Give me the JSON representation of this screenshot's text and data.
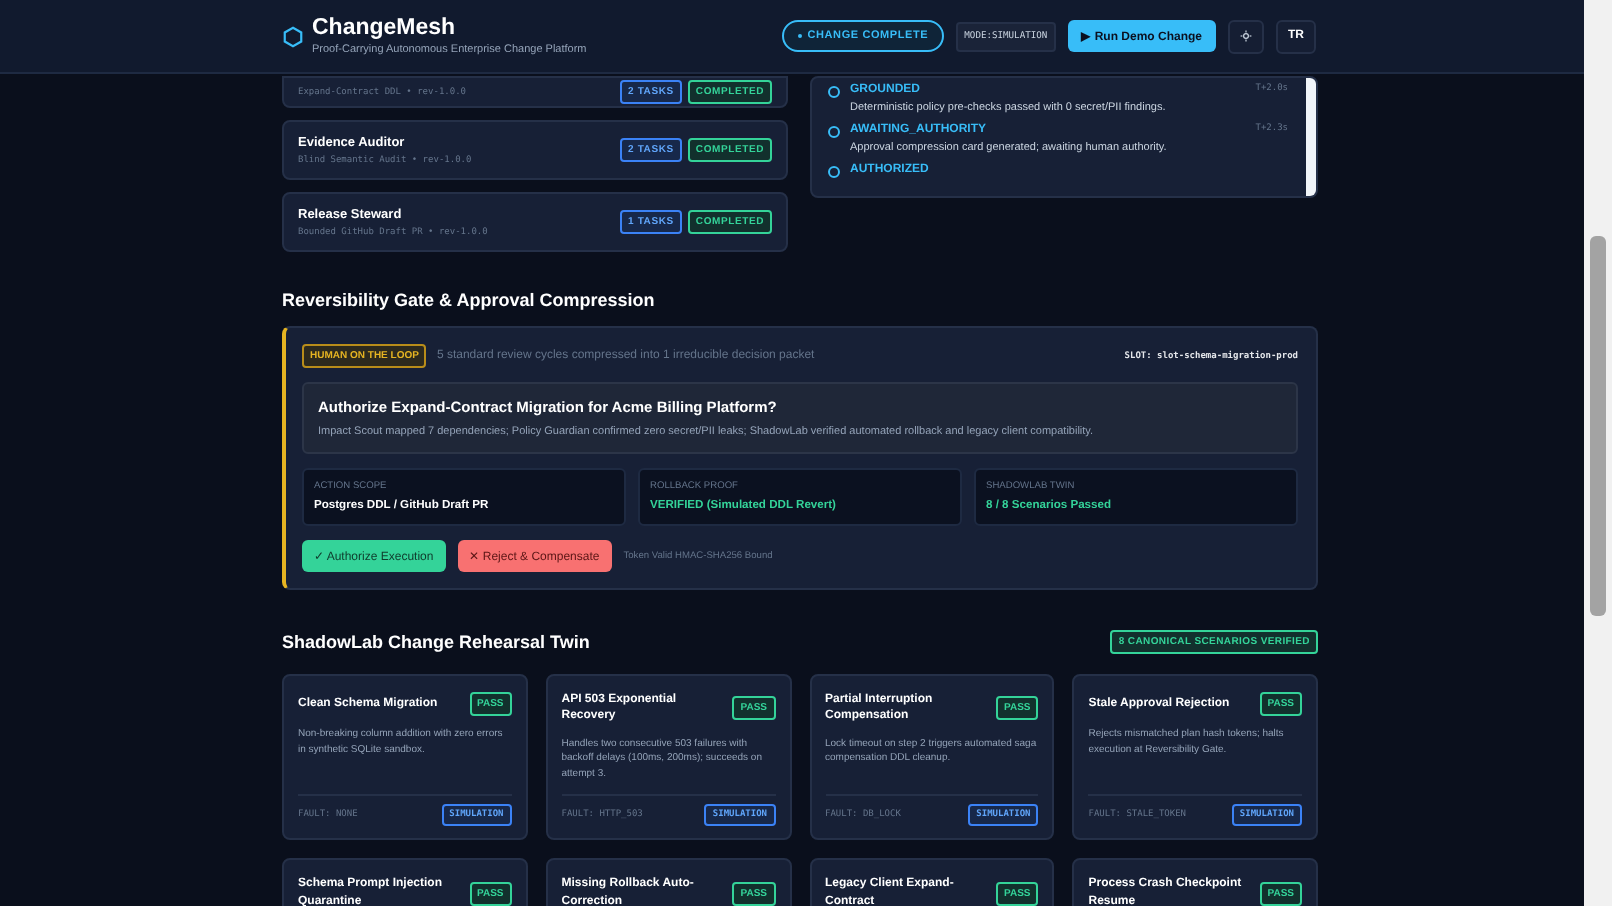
{
  "header": {
    "title": "ChangeMesh",
    "subtitle": "Proof-Carrying Autonomous Enterprise Change Platform",
    "status": "CHANGE COMPLETE",
    "mode": "MODE:SIMULATION",
    "run_button": "▶ Run Demo Change",
    "user": "TR"
  },
  "agents": [
    {
      "subtitle": "Expand-Contract DDL • rev-1.0.0",
      "tasks": "2 TASKS",
      "status": "COMPLETED",
      "kind": "done"
    },
    {
      "name": "Evidence Auditor",
      "subtitle": "Blind Semantic Audit • rev-1.0.0",
      "tasks": "2 TASKS",
      "status": "COMPLETED",
      "kind": "done"
    },
    {
      "name": "Release Steward",
      "subtitle": "Bounded GitHub Draft PR • rev-1.0.0",
      "tasks": "1 TASKS",
      "status": "COMPLETED",
      "kind": "done"
    }
  ],
  "timeline": [
    {
      "state": "GROUNDED",
      "time": "T+2.0s",
      "description": "Deterministic policy pre-checks passed with 0 secret/PII findings."
    },
    {
      "state": "AWAITING_AUTHORITY",
      "time": "T+2.3s",
      "description": "Approval compression card generated; awaiting human authority."
    },
    {
      "state": "AUTHORIZED"
    }
  ],
  "gate": {
    "title": "Reversibility Gate & Approval Compression",
    "badge": "HUMAN ON THE LOOP",
    "summary": "5 standard review cycles compressed into 1 irreducible decision packet",
    "slot": "SLOT: slot-schema-migration-prod",
    "question": "Authorize Expand-Contract Migration for Acme Billing Platform?",
    "question_detail": "Impact Scout mapped 7 dependencies; Policy Guardian confirmed zero secret/PII leaks; ShadowLab verified automated rollback and legacy client compatibility.",
    "facts": [
      {
        "label": "ACTION SCOPE",
        "value": "Postgres DDL / GitHub Draft PR",
        "kind": "plain"
      },
      {
        "label": "ROLLBACK PROOF",
        "value": "VERIFIED (Simulated DDL Revert)",
        "kind": "verified"
      },
      {
        "label": "SHADOWLAB TWIN",
        "value": "8 / 8 Scenarios Passed",
        "kind": "verified"
      }
    ],
    "approve_button": "✓ Authorize Execution",
    "reject_button": "✕ Reject & Compensate",
    "token_note": "Token Valid HMAC-SHA256 Bound"
  },
  "shadowlab": {
    "title": "ShadowLab Change Rehearsal Twin",
    "badge": "8 CANONICAL SCENARIOS VERIFIED",
    "scenarios": [
      {
        "title": "Clean Schema Migration",
        "result": "PASS",
        "description": "Non-breaking column addition with zero errors in synthetic SQLite sandbox.",
        "fault": "FAULT: NONE",
        "mode": "SIMULATION"
      },
      {
        "title": "API 503 Exponential Recovery",
        "result": "PASS",
        "description": "Handles two consecutive 503 failures with backoff delays (100ms, 200ms); succeeds on attempt 3.",
        "fault": "FAULT: HTTP_503",
        "mode": "SIMULATION"
      },
      {
        "title": "Partial Interruption Compensation",
        "result": "PASS",
        "description": "Lock timeout on step 2 triggers automated saga compensation DDL cleanup.",
        "fault": "FAULT: DB_LOCK",
        "mode": "SIMULATION"
      },
      {
        "title": "Stale Approval Rejection",
        "result": "PASS",
        "description": "Rejects mismatched plan hash tokens; halts execution at Reversibility Gate.",
        "fault": "FAULT: STALE_TOKEN",
        "mode": "SIMULATION"
      },
      {
        "title": "Schema Prompt Injection Quarantine",
        "result": "PASS"
      },
      {
        "title": "Missing Rollback Auto-Correction",
        "result": "PASS"
      },
      {
        "title": "Legacy Client Expand-Contract",
        "result": "PASS"
      },
      {
        "title": "Process Crash Checkpoint Resume",
        "result": "PASS"
      }
    ]
  }
}
